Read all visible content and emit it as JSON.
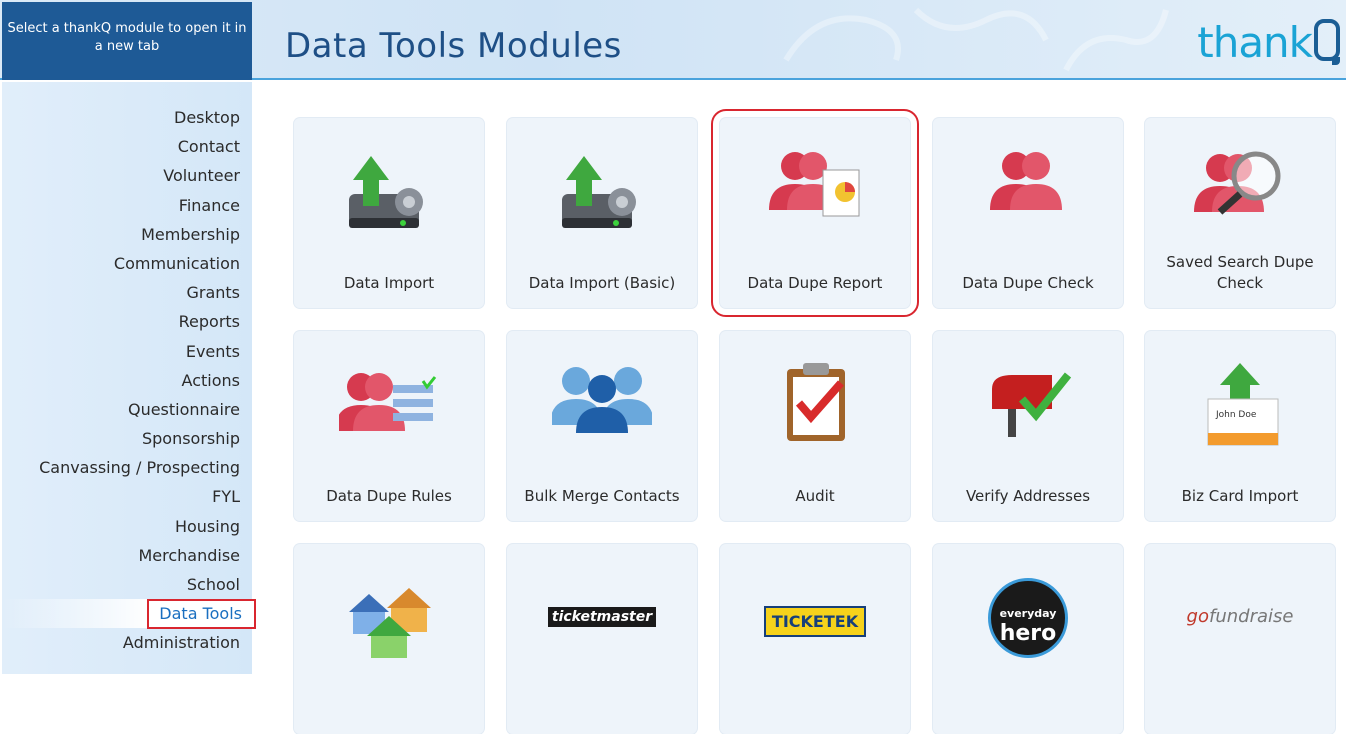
{
  "sidebar_hint": "Select a thankQ module to open it in a new tab",
  "page_title": "Data Tools Modules",
  "logo_text": "thank",
  "nav": [
    "Desktop",
    "Contact",
    "Volunteer",
    "Finance",
    "Membership",
    "Communication",
    "Grants",
    "Reports",
    "Events",
    "Actions",
    "Questionnaire",
    "Sponsorship",
    "Canvassing / Prospecting",
    "FYL",
    "Housing",
    "Merchandise",
    "School",
    "Data Tools",
    "Administration"
  ],
  "active_nav": "Data Tools",
  "tiles": [
    {
      "label": "Data Import",
      "icon": "server-upload-icon"
    },
    {
      "label": "Data Import (Basic)",
      "icon": "server-upload-icon"
    },
    {
      "label": "Data Dupe Report",
      "icon": "dupe-report-icon",
      "selected": true
    },
    {
      "label": "Data Dupe Check",
      "icon": "dupe-people-icon"
    },
    {
      "label": "Saved Search Dupe Check",
      "icon": "dupe-search-icon"
    },
    {
      "label": "Data Dupe Rules",
      "icon": "dupe-rules-icon"
    },
    {
      "label": "Bulk Merge Contacts",
      "icon": "merge-people-icon"
    },
    {
      "label": "Audit",
      "icon": "clipboard-check-icon"
    },
    {
      "label": "Verify Addresses",
      "icon": "mailbox-check-icon"
    },
    {
      "label": "Biz Card Import",
      "icon": "business-card-upload-icon"
    },
    {
      "label": "",
      "icon": "houses-icon"
    },
    {
      "label": "",
      "icon": "ticketmaster-logo",
      "brand": "ticketmaster"
    },
    {
      "label": "",
      "icon": "ticketek-logo",
      "brand": "TICKETEK"
    },
    {
      "label": "",
      "icon": "everyday-hero-logo",
      "brand": "everyday hero"
    },
    {
      "label": "",
      "icon": "gofundraise-logo",
      "brand": "gofundraise"
    }
  ],
  "colors": {
    "header_dark": "#1e5a96",
    "title": "#1e4f86",
    "accent": "#1aa3d5",
    "highlight": "#d9262f",
    "tile_bg": "#eef4fa"
  }
}
